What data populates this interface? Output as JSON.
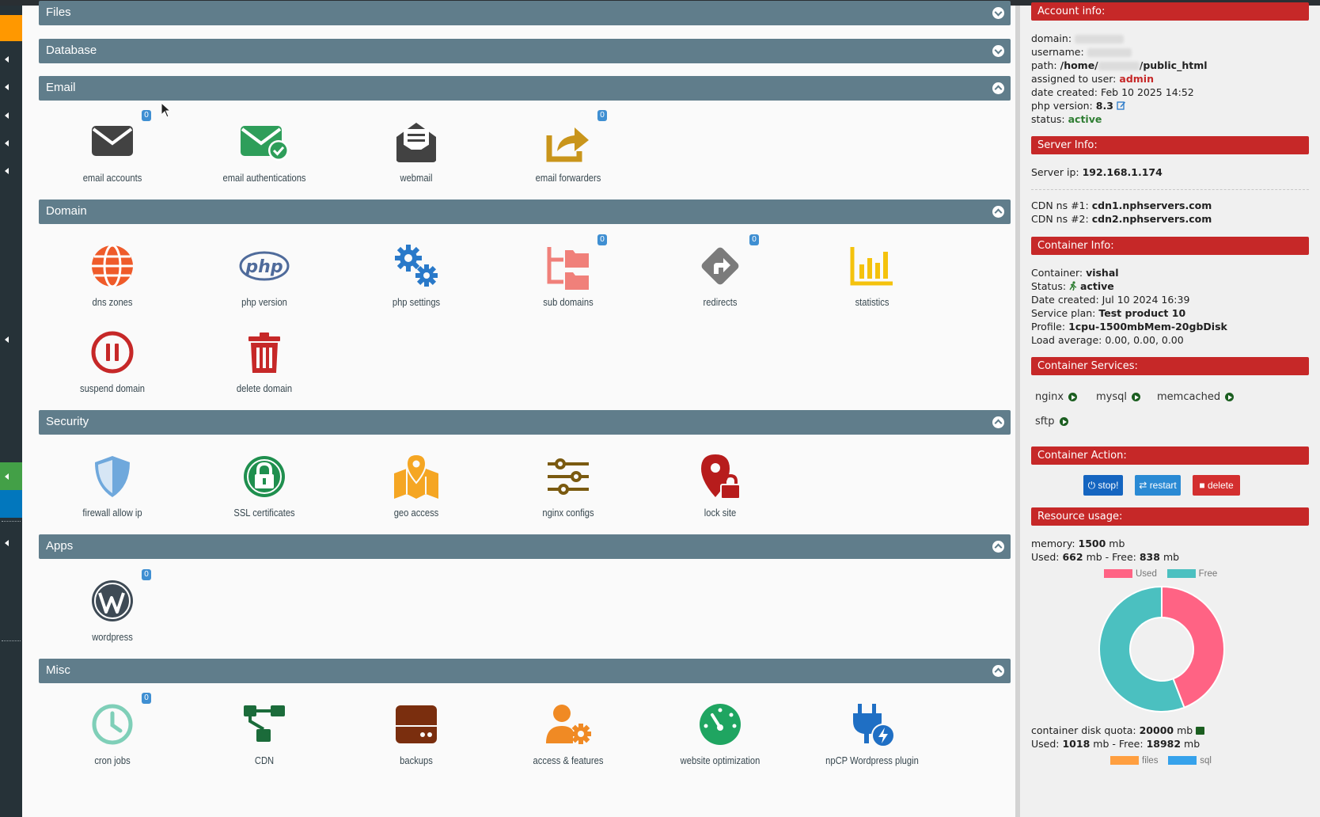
{
  "colors": {
    "section_bar": "#607d8b",
    "sidebar_header": "#c62828",
    "badge": "#3f8fd2",
    "chart_used": "#ff6384",
    "chart_free": "#4bc0c0",
    "chart_files": "#ff9f40",
    "chart_sql": "#36a2eb"
  },
  "sections": {
    "files": "Files",
    "database": "Database",
    "email": "Email",
    "domain": "Domain",
    "security": "Security",
    "apps": "Apps",
    "misc": "Misc"
  },
  "email": {
    "accounts": {
      "label": "email accounts",
      "badge": "0",
      "icon": "envelope-icon"
    },
    "authentications": {
      "label": "email authentications",
      "icon": "envelope-check-icon"
    },
    "webmail": {
      "label": "webmail",
      "icon": "envelope-open-icon"
    },
    "forwarders": {
      "label": "email forwarders",
      "badge": "0",
      "icon": "share-icon"
    }
  },
  "domain": {
    "dns_zones": {
      "label": "dns zones",
      "icon": "globe-icon"
    },
    "php_version": {
      "label": "php version",
      "icon": "php-icon"
    },
    "php_settings": {
      "label": "php settings",
      "icon": "gears-icon"
    },
    "sub_domains": {
      "label": "sub domains",
      "badge": "0",
      "icon": "folder-tree-icon"
    },
    "redirects": {
      "label": "redirects",
      "badge": "0",
      "icon": "diamond-turn-right-icon"
    },
    "statistics": {
      "label": "statistics",
      "icon": "bar-chart-icon"
    },
    "suspend": {
      "label": "suspend domain",
      "icon": "pause-circle-icon"
    },
    "delete": {
      "label": "delete domain",
      "icon": "trash-icon"
    }
  },
  "security": {
    "firewall": {
      "label": "firewall allow ip",
      "icon": "shield-icon"
    },
    "ssl": {
      "label": "SSL certificates",
      "icon": "lock-badge-icon"
    },
    "geo": {
      "label": "geo access",
      "icon": "map-location-icon"
    },
    "nginx": {
      "label": "nginx configs",
      "icon": "sliders-icon"
    },
    "lock": {
      "label": "lock site",
      "icon": "location-lock-icon"
    }
  },
  "apps": {
    "wordpress": {
      "label": "wordpress",
      "badge": "0",
      "icon": "wordpress-icon"
    }
  },
  "misc": {
    "cron": {
      "label": "cron jobs",
      "badge": "0",
      "icon": "clock-icon"
    },
    "cdn": {
      "label": "CDN",
      "icon": "network-icon"
    },
    "backups": {
      "label": "backups",
      "icon": "hard-drive-icon"
    },
    "access": {
      "label": "access & features",
      "icon": "user-gear-icon"
    },
    "optimization": {
      "label": "website optimization",
      "icon": "gauge-icon"
    },
    "wp_plugin": {
      "label": "npCP Wordpress plugin",
      "icon": "plug-bolt-icon"
    }
  },
  "account": {
    "header": "Account info:",
    "domain_label": "domain:",
    "username_label": "username:",
    "path_label": "path:",
    "path_prefix": "/home/",
    "path_suffix": "/public_html",
    "assigned_label": "assigned to user:",
    "assigned_value": "admin",
    "date_label": "date created:",
    "date_value": "Feb 10 2025 14:52",
    "php_label": "php version:",
    "php_value": "8.3",
    "status_label": "status:",
    "status_value": "active"
  },
  "server": {
    "header": "Server Info:",
    "ip_label": "Server ip:",
    "ip_value": "192.168.1.174",
    "cdn1_label": "CDN ns #1:",
    "cdn1_value": "cdn1.nphservers.com",
    "cdn2_label": "CDN ns #2:",
    "cdn2_value": "cdn2.nphservers.com"
  },
  "container": {
    "header": "Container Info:",
    "name_label": "Container:",
    "name_value": "vishal",
    "status_label": "Status:",
    "status_value": "active",
    "date_label": "Date created:",
    "date_value": "Jul 10 2024 16:39",
    "plan_label": "Service plan:",
    "plan_value": "Test product 10",
    "profile_label": "Profile:",
    "profile_value": "1cpu-1500mbMem-20gbDisk",
    "load_label": "Load average:",
    "load_value": "0.00, 0.00, 0.00"
  },
  "services": {
    "header": "Container Services:",
    "items": [
      "nginx",
      "mysql",
      "memcached",
      "sftp"
    ]
  },
  "actions": {
    "header": "Container Action:",
    "stop": "stop!",
    "restart": "restart",
    "delete": "delete"
  },
  "resources": {
    "header": "Resource usage:",
    "memory_label": "memory:",
    "memory_value": "1500",
    "memory_unit": "mb",
    "used_label": "Used:",
    "used_value": "662",
    "free_label": "mb - Free:",
    "free_value": "838",
    "unit": "mb",
    "disk_label": "container disk quota:",
    "disk_value": "20000",
    "disk_unit": "mb",
    "disk_used_label": "Used:",
    "disk_used_value": "1018",
    "disk_free_label": "mb - Free:",
    "disk_free_value": "18982",
    "disk_unit2": "mb"
  },
  "chart_data": [
    {
      "type": "pie",
      "labels": [
        "Used",
        "Free"
      ],
      "values": [
        662,
        838
      ],
      "legend": "top"
    },
    {
      "type": "pie",
      "labels": [
        "files",
        "sql"
      ],
      "values": [],
      "legend": "top"
    }
  ]
}
